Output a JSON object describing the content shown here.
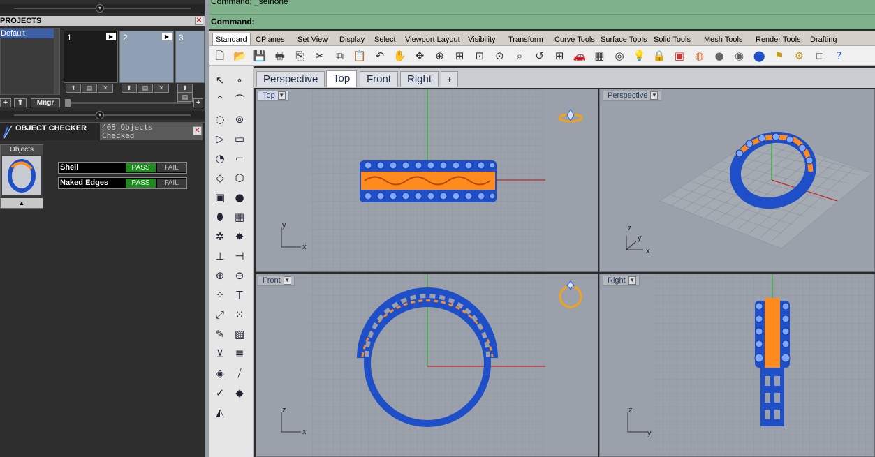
{
  "left_panel": {
    "projects": {
      "title": "PROJECTS",
      "close": "✕",
      "list_selected": "Default",
      "thumbs": [
        {
          "num": "1",
          "arrow": "▶"
        },
        {
          "num": "2",
          "arrow": "▶"
        },
        {
          "num": "3",
          "arrow": ""
        }
      ],
      "thumb_buttons": [
        "⬆",
        "▤",
        "✕"
      ],
      "toolbar": {
        "add": "+",
        "up": "⬆",
        "manager": "Mngr",
        "right_add": "+"
      }
    },
    "grip": "▾",
    "object_checker": {
      "title": "OBJECT CHECKER",
      "count_line1": "408  Objects",
      "count_line2": "Checked",
      "close": "✕",
      "objects_tab": "Objects",
      "up_arrow": "▲",
      "checks": [
        {
          "name": "Shell",
          "pass": "PASS",
          "fail": "FAIL"
        },
        {
          "name": "Naked Edges",
          "pass": "PASS",
          "fail": "FAIL"
        }
      ]
    }
  },
  "command": {
    "history": "Command: _selnone",
    "prompt": "Command:"
  },
  "menu_tabs": [
    "Standard",
    "CPlanes",
    "Set View",
    "Display",
    "Select",
    "Viewport Layout",
    "Visibility",
    "Transform",
    "Curve Tools",
    "Surface Tools",
    "Solid Tools",
    "Mesh Tools",
    "Render Tools",
    "Drafting"
  ],
  "standard_icons": [
    "new-file-icon",
    "open-folder-icon",
    "save-icon",
    "print-icon",
    "import-icon",
    "cut-icon",
    "copy-icon",
    "paste-icon",
    "undo-icon",
    "pan-hand-icon",
    "rotate-view-icon",
    "zoom-icon",
    "zoom-window-icon",
    "zoom-extents-icon",
    "zoom-selected-icon",
    "zoom-target-icon",
    "zoom-previous-icon",
    "four-viewports-icon",
    "car-icon",
    "grid-icon",
    "snap-icon",
    "light-bulb-icon",
    "lock-icon",
    "layer-icon",
    "color-wheel-icon",
    "render-sphere-icon",
    "material-sphere-icon",
    "blue-sphere-icon",
    "tools-icon",
    "gear-icon",
    "transform-icon",
    "help-icon"
  ],
  "viewport_tabs": [
    "Perspective",
    "Top",
    "Front",
    "Right",
    "+"
  ],
  "active_viewport_tab": "Top",
  "viewports": {
    "top": {
      "label": "Top",
      "axis_a": "y",
      "axis_b": "x"
    },
    "perspective": {
      "label": "Perspective",
      "axis_a": "z",
      "axis_b": "y",
      "axis_c": "x"
    },
    "front": {
      "label": "Front",
      "axis_a": "z",
      "axis_b": "x"
    },
    "right": {
      "label": "Right",
      "axis_a": "z",
      "axis_b": "y"
    }
  },
  "colors": {
    "ring_blue": "#1f4fc8",
    "ring_orange": "#ff8a1e",
    "command_bg": "#7fb28a",
    "viewport_bg": "#9aa1aa",
    "grid_line": "#8d949d",
    "axis_red": "#c42323",
    "axis_green": "#20b020"
  }
}
